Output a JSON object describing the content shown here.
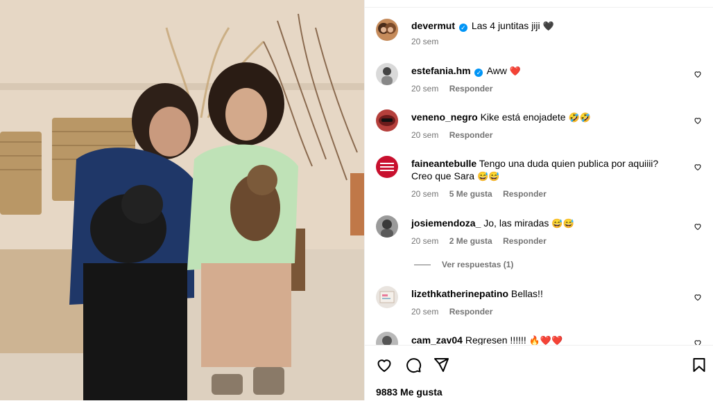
{
  "post": {
    "author": "devermut",
    "caption": "Las 4 juntitas jiji",
    "caption_emoji": "🖤",
    "time": "20 sem"
  },
  "comments": [
    {
      "user": "estefania.hm",
      "verified": true,
      "text": "Aww",
      "emoji": "❤️",
      "time": "20 sem",
      "likes": "",
      "reply": "Responder"
    },
    {
      "user": "veneno_negro",
      "verified": false,
      "text": "Kike está enojadete",
      "emoji": "🤣🤣",
      "time": "20 sem",
      "likes": "",
      "reply": "Responder"
    },
    {
      "user": "faineantebulle",
      "verified": false,
      "text": "Tengo una duda quien publica por aquiiii? Creo que Sara",
      "emoji": "😅😅",
      "time": "20 sem",
      "likes": "5 Me gusta",
      "reply": "Responder"
    },
    {
      "user": "josiemendoza_",
      "verified": false,
      "text": "Jo, las miradas",
      "emoji": "😅😅",
      "time": "20 sem",
      "likes": "2 Me gusta",
      "reply": "Responder"
    },
    {
      "user": "lizethkatherinepatino",
      "verified": false,
      "text": "Bellas!!",
      "emoji": "",
      "time": "20 sem",
      "likes": "",
      "reply": "Responder"
    },
    {
      "user": "cam_zav04",
      "verified": false,
      "text": "Regresen !!!!!!",
      "emoji": "🔥❤️❤️",
      "time": "",
      "likes": "",
      "reply": ""
    }
  ],
  "view_replies": "Ver respuestas (1)",
  "likes_label": "9883 Me gusta",
  "colors": {
    "verified": "#0095f6",
    "meta": "#737373",
    "divider": "#efefef"
  }
}
